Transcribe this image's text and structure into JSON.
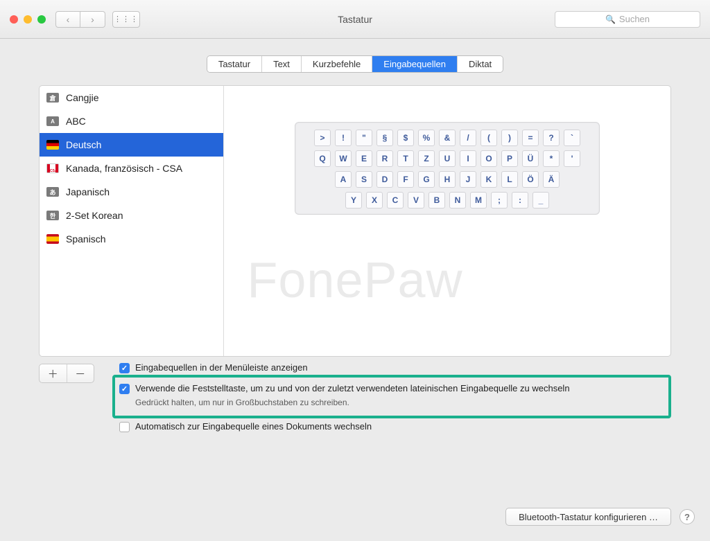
{
  "window": {
    "title": "Tastatur"
  },
  "search": {
    "placeholder": "Suchen"
  },
  "tabs": [
    "Tastatur",
    "Text",
    "Kurzbefehle",
    "Eingabequellen",
    "Diktat"
  ],
  "tabs_active_index": 3,
  "sources": [
    {
      "label": "Cangjie",
      "glyph": "倉"
    },
    {
      "label": "ABC",
      "glyph": "A"
    },
    {
      "label": "Deutsch",
      "glyph": ""
    },
    {
      "label": "Kanada, französisch - CSA",
      "glyph": ""
    },
    {
      "label": "Japanisch",
      "glyph": "あ"
    },
    {
      "label": "2-Set Korean",
      "glyph": "한"
    },
    {
      "label": "Spanisch",
      "glyph": ""
    }
  ],
  "selected_source_index": 2,
  "keyboard_rows": [
    [
      ">",
      "!",
      "\"",
      "§",
      "$",
      "%",
      "&",
      "/",
      "(",
      ")",
      "=",
      "?",
      "`"
    ],
    [
      "Q",
      "W",
      "E",
      "R",
      "T",
      "Z",
      "U",
      "I",
      "O",
      "P",
      "Ü",
      "*",
      "'"
    ],
    [
      "A",
      "S",
      "D",
      "F",
      "G",
      "H",
      "J",
      "K",
      "L",
      "Ö",
      "Ä"
    ],
    [
      "Y",
      "X",
      "C",
      "V",
      "B",
      "N",
      "M",
      ";",
      ":",
      "_"
    ]
  ],
  "options": {
    "menubar": {
      "checked": true,
      "label": "Eingabequellen in der Menüleiste anzeigen"
    },
    "capslock": {
      "checked": true,
      "label": "Verwende die Feststelltaste, um zu und von der zuletzt verwendeten lateinischen Eingabequelle zu wechseln",
      "hint": "Gedrückt halten, um nur in Großbuchstaben zu schreiben."
    },
    "autoswitch": {
      "checked": false,
      "label": "Automatisch zur Eingabequelle eines Dokuments wechseln"
    }
  },
  "bottom_button": "Bluetooth-Tastatur konfigurieren …",
  "watermark": "FonePaw",
  "ca_sub": "CSA"
}
